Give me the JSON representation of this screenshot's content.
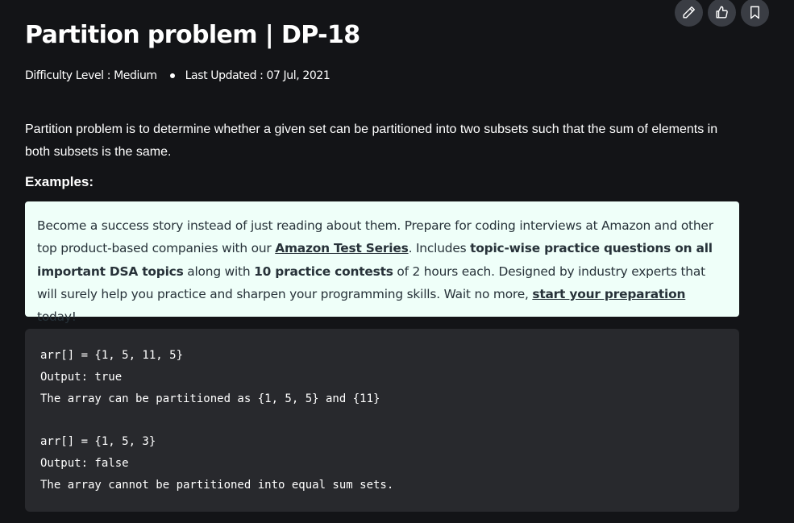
{
  "toolbar": {
    "edit_icon": "pencil-icon",
    "like_icon": "thumbs-up-icon",
    "bookmark_icon": "bookmark-icon"
  },
  "article": {
    "title": "Partition problem | DP-18",
    "difficulty": "Difficulty Level : Medium",
    "last_updated": "Last Updated : 07 Jul, 2021",
    "intro": "Partition problem is to determine whether a given set can be partitioned into two subsets such that the sum of elements in both subsets is the same.",
    "examples_heading": "Examples:"
  },
  "promo": {
    "text_1": "Become a success story instead of just reading about them. Prepare for coding interviews at Amazon and other top product-based companies with our ",
    "link_1": "Amazon Test Series",
    "text_2": ". Includes ",
    "bold_1": "topic-wise practice questions on all important DSA topics",
    "text_3": " along with ",
    "bold_2": "10 practice contests",
    "text_4": " of 2 hours each. Designed by industry experts that will surely help you practice and sharpen your programming skills. Wait no more, ",
    "link_2": "start your preparation",
    "text_5": " today!",
    "background": "#effff9",
    "text_color": "#273239"
  },
  "code": {
    "lines": [
      "arr[] = {1, 5, 11, 5}",
      "Output: true",
      "The array can be partitioned as {1, 5, 5} and {11}",
      "",
      "arr[] = {1, 5, 3}",
      "Output: false",
      "The array cannot be partitioned into equal sum sets."
    ]
  },
  "colors": {
    "page_background": "#131417",
    "code_background": "#28292d",
    "button_background": "#3a3d44"
  }
}
